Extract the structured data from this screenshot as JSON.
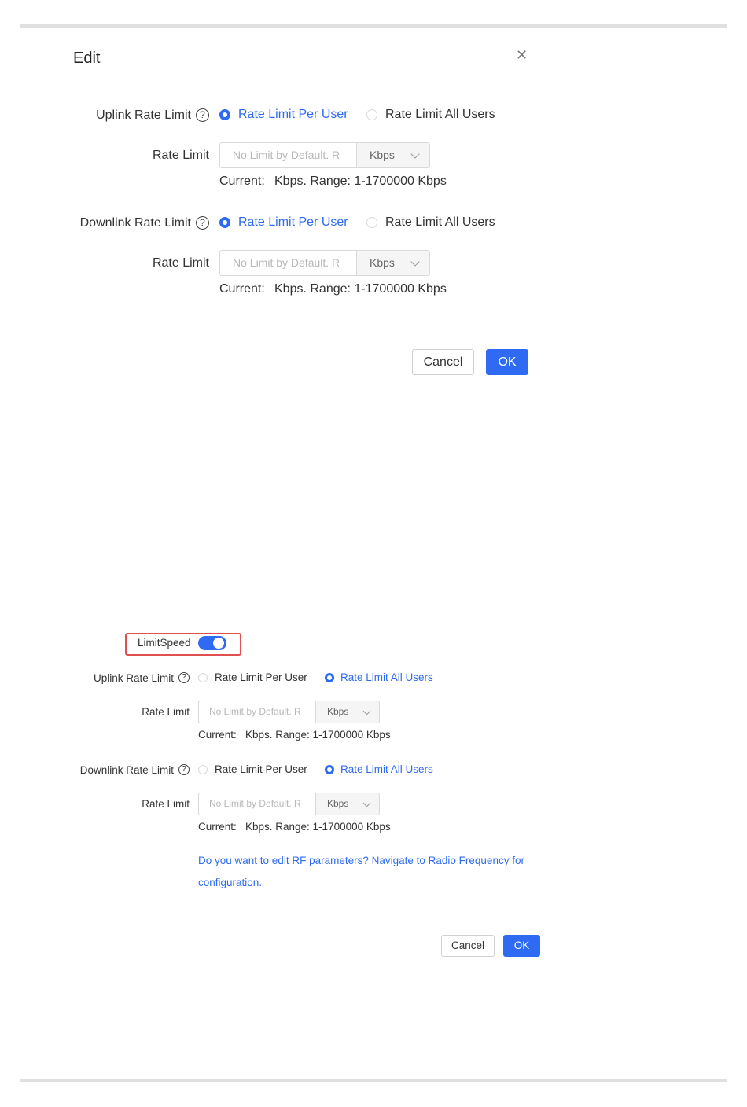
{
  "dialog_large": {
    "title": "Edit",
    "uplink": {
      "label": "Uplink Rate Limit",
      "option_per_user": "Rate Limit Per User",
      "option_all_users": "Rate Limit All Users",
      "selected": "per_user",
      "rate_limit_label": "Rate Limit",
      "input_placeholder": "No Limit by Default. R",
      "unit": "Kbps",
      "current_label": "Current:",
      "range_text": "Kbps. Range: 1-1700000 Kbps"
    },
    "downlink": {
      "label": "Downlink Rate Limit",
      "option_per_user": "Rate Limit Per User",
      "option_all_users": "Rate Limit All Users",
      "selected": "per_user",
      "rate_limit_label": "Rate Limit",
      "input_placeholder": "No Limit by Default. R",
      "unit": "Kbps",
      "current_label": "Current:",
      "range_text": "Kbps. Range: 1-1700000 Kbps"
    },
    "cancel_label": "Cancel",
    "ok_label": "OK"
  },
  "dialog_small": {
    "limit_speed_label": "LimitSpeed",
    "limit_speed_on": true,
    "uplink": {
      "label": "Uplink Rate Limit",
      "option_per_user": "Rate Limit Per User",
      "option_all_users": "Rate Limit All Users",
      "selected": "all_users",
      "rate_limit_label": "Rate Limit",
      "input_placeholder": "No Limit by Default. R",
      "unit": "Kbps",
      "current_label": "Current:",
      "range_text": "Kbps. Range: 1-1700000 Kbps"
    },
    "downlink": {
      "label": "Downlink Rate Limit",
      "option_per_user": "Rate Limit Per User",
      "option_all_users": "Rate Limit All Users",
      "selected": "all_users",
      "rate_limit_label": "Rate Limit",
      "input_placeholder": "No Limit by Default. R",
      "unit": "Kbps",
      "current_label": "Current:",
      "range_text": "Kbps. Range: 1-1700000 Kbps"
    },
    "rf_link": "Do you want to edit RF parameters? Navigate to Radio Frequency for configuration.",
    "cancel_label": "Cancel",
    "ok_label": "OK"
  },
  "icons": {
    "help": "question-circle-icon",
    "close": "close-icon",
    "dropdown": "chevron-down-icon"
  },
  "colors": {
    "accent": "#2f6bf2",
    "highlight_border": "#e05050",
    "divider": "#e0e0e0"
  }
}
